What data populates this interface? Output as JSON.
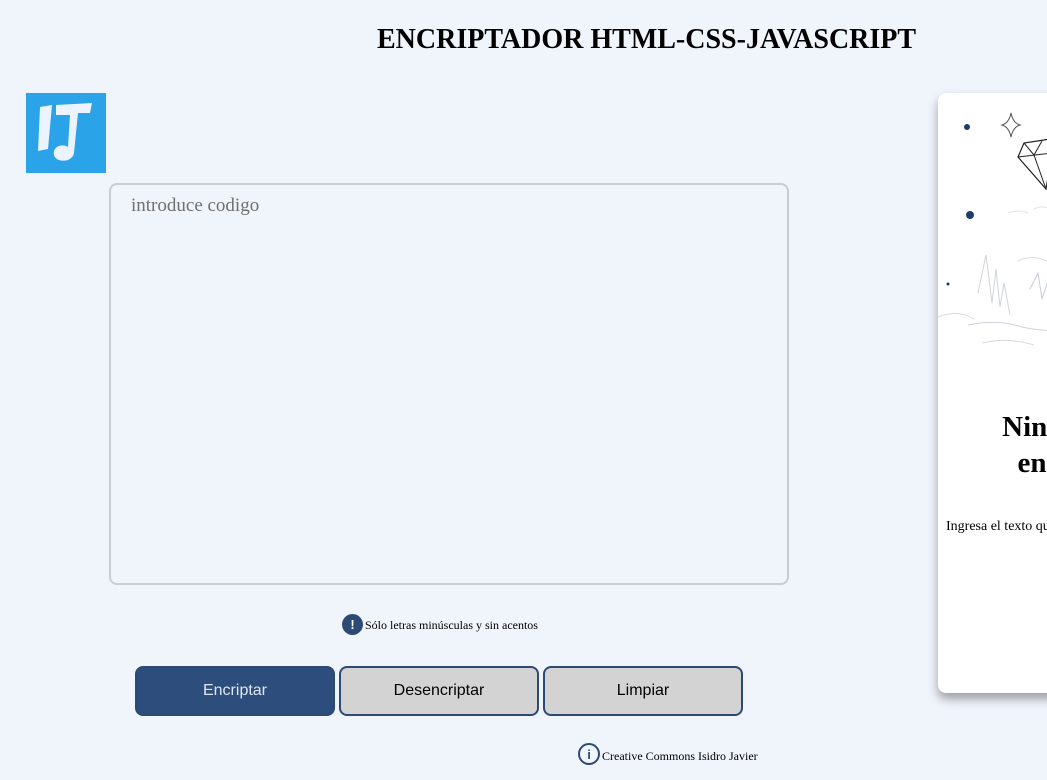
{
  "header": {
    "title": "ENCRIPTADOR HTML-CSS-JAVASCRIPT"
  },
  "logo": {
    "icon": "brand-logo-icon",
    "background": "#2aa3e8"
  },
  "editor": {
    "placeholder": "introduce codigo",
    "value": ""
  },
  "hint": {
    "icon": "exclamation-icon",
    "icon_glyph": "!",
    "text": "Sólo letras minúsculas y sin acentos"
  },
  "buttons": {
    "encrypt": "Encriptar",
    "decrypt": "Desencriptar",
    "clear": "Limpiar"
  },
  "footer": {
    "icon": "info-icon",
    "icon_glyph": "i",
    "text": "Creative Commons Isidro Javier"
  },
  "result_panel": {
    "illustration": "diamond-illustration",
    "heading_line1": "Ning",
    "heading_line2": "en",
    "text": "Ingresa el texto qu"
  },
  "colors": {
    "background": "#f0f4fb",
    "primary": "#2d4e7c",
    "secondary": "#d3d3d3",
    "accent": "#2d4a74"
  }
}
